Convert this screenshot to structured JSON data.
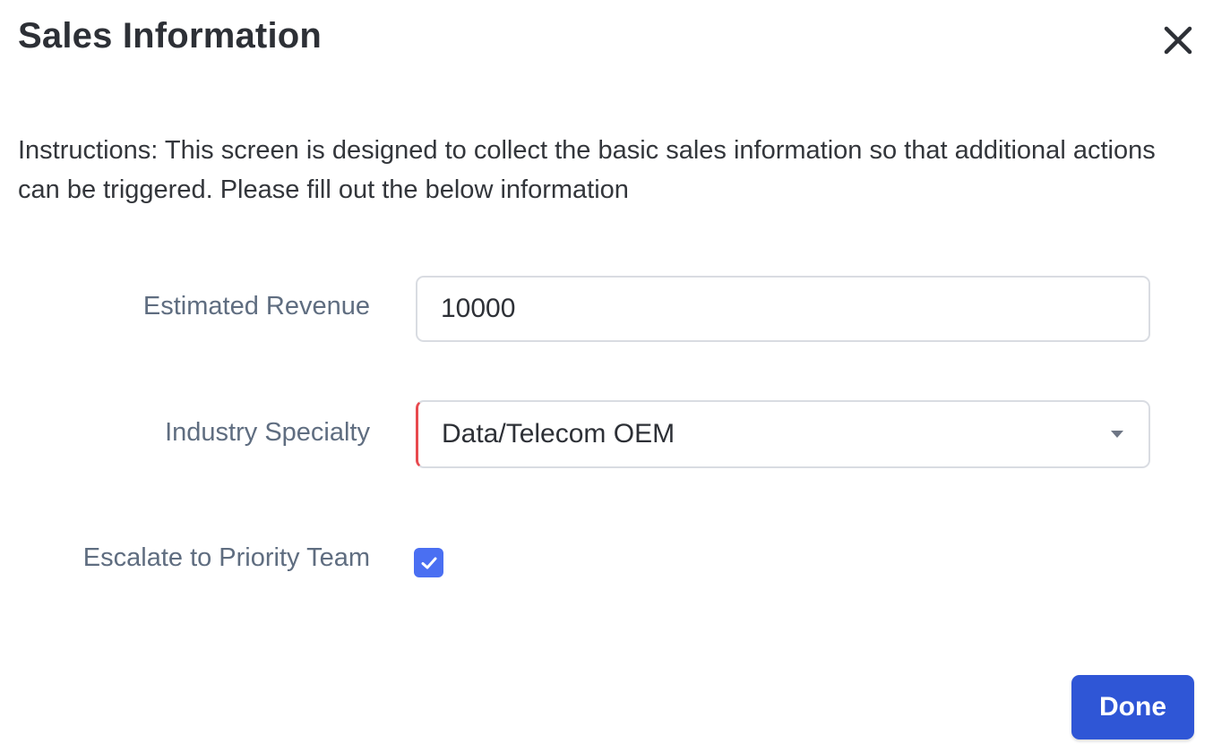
{
  "dialog": {
    "title": "Sales Information",
    "close_icon": "close-icon",
    "instructions": "Instructions: This screen is designed to collect the basic sales information so that additional actions can be triggered. Please fill out the below information"
  },
  "form": {
    "estimated_revenue": {
      "label": "Estimated Revenue",
      "value": "10000"
    },
    "industry_specialty": {
      "label": "Industry Specialty",
      "selected": "Data/Telecom OEM",
      "icon": "chevron-down-icon"
    },
    "escalate": {
      "label": "Escalate to Priority Team",
      "checked": true,
      "icon": "checkmark-icon"
    }
  },
  "footer": {
    "done_label": "Done"
  },
  "colors": {
    "accent": "#2f56d6",
    "checkbox": "#4a6ff2",
    "required_marker": "#e8494e",
    "label_text": "#5f6d80"
  }
}
